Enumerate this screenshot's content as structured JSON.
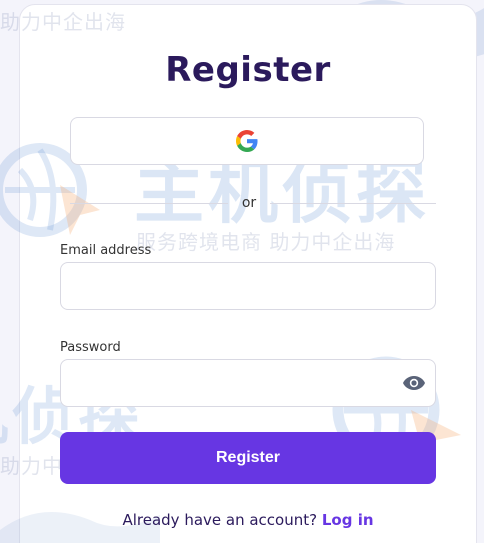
{
  "title": "Register",
  "google_button": {
    "icon": "google-icon"
  },
  "divider": {
    "text": "or"
  },
  "email": {
    "label": "Email address",
    "value": "",
    "placeholder": ""
  },
  "password": {
    "label": "Password",
    "value": "",
    "placeholder": "",
    "icon": "eye-icon"
  },
  "submit": {
    "label": "Register"
  },
  "footer": {
    "prompt": "Already have an account?",
    "link": "Log in"
  },
  "watermark": {
    "brand": "主机侦探",
    "tagline": "服务跨境电商 助力中企出海",
    "tagline_short": "助力中企出海"
  },
  "colors": {
    "accent": "#6736e3",
    "title": "#2b1a5c",
    "border": "#d9d9e3",
    "background": "#f4f4fb"
  }
}
